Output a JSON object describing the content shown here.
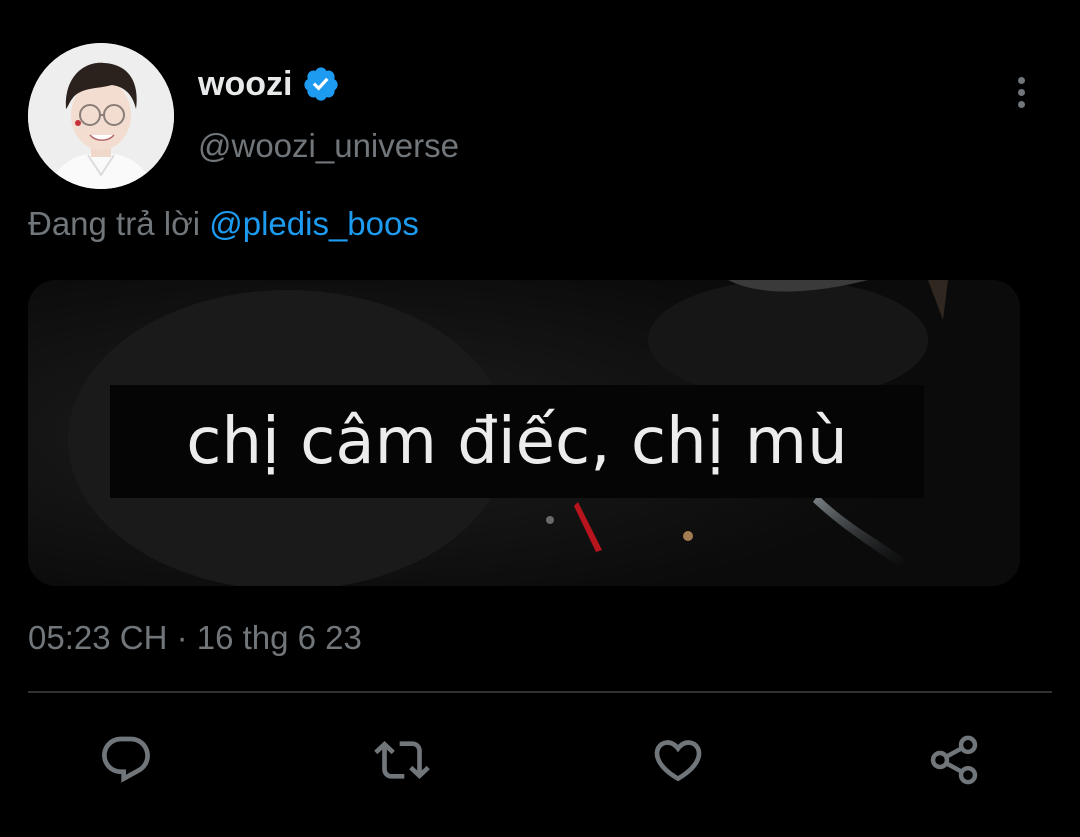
{
  "tweet": {
    "author": {
      "display_name": "woozi",
      "handle": "@woozi_universe",
      "verified": true
    },
    "reply_prefix": "Đang trả lời",
    "reply_to": "@pledis_boos",
    "media_caption": "chị câm điếc, chị mù",
    "timestamp": "05:23 CH · 16 thg 6 23"
  },
  "icons": {
    "more": "more-vertical-icon",
    "verified": "verified-badge-icon",
    "reply": "reply-icon",
    "retweet": "retweet-icon",
    "like": "heart-icon",
    "share": "share-icon"
  },
  "colors": {
    "background": "#000000",
    "text_primary": "#e7e9ea",
    "text_secondary": "#71767b",
    "accent": "#1d9bf0",
    "divider": "#2f3336"
  }
}
